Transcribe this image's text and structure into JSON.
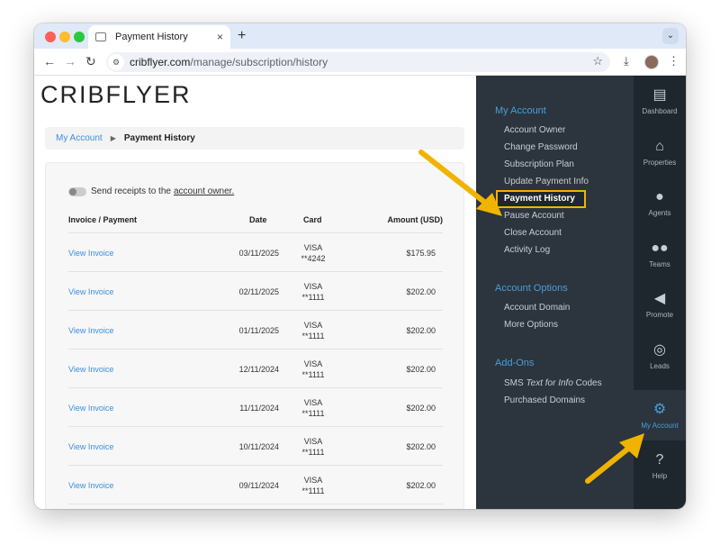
{
  "browser": {
    "tab_title": "Payment History",
    "close_tab": "×",
    "new_tab": "+",
    "url_domain": "cribflyer.com",
    "url_path": "/manage/subscription/history",
    "nav": {
      "back": "←",
      "forward": "→",
      "reload": "↻"
    },
    "star": "☆",
    "download": "⤓",
    "menu": "⋮",
    "tab_menu": "⌄",
    "colors": {
      "close": "#ff5f57",
      "minimize": "#febc2e",
      "maximize": "#28c840"
    }
  },
  "brand": {
    "logo_text": "CRIBFLYER"
  },
  "breadcrumb": {
    "parent": "My Account",
    "separator": "▶",
    "current": "Payment History"
  },
  "settings": {
    "toggle_label": "Send receipts to the",
    "toggle_link": "account owner.",
    "toggle_on": false
  },
  "table": {
    "columns": [
      "Invoice / Payment",
      "Date",
      "Card",
      "Amount (USD)"
    ],
    "rows": [
      {
        "invoice": "View Invoice",
        "date": "03/11/2025",
        "brand": "VISA",
        "last4": "**4242",
        "amount": "$175.95"
      },
      {
        "invoice": "View Invoice",
        "date": "02/11/2025",
        "brand": "VISA",
        "last4": "**1111",
        "amount": "$202.00"
      },
      {
        "invoice": "View Invoice",
        "date": "01/11/2025",
        "brand": "VISA",
        "last4": "**1111",
        "amount": "$202.00"
      },
      {
        "invoice": "View Invoice",
        "date": "12/11/2024",
        "brand": "VISA",
        "last4": "**1111",
        "amount": "$202.00"
      },
      {
        "invoice": "View Invoice",
        "date": "11/11/2024",
        "brand": "VISA",
        "last4": "**1111",
        "amount": "$202.00"
      },
      {
        "invoice": "View Invoice",
        "date": "10/11/2024",
        "brand": "VISA",
        "last4": "**1111",
        "amount": "$202.00"
      },
      {
        "invoice": "View Invoice",
        "date": "09/11/2024",
        "brand": "VISA",
        "last4": "**1111",
        "amount": "$202.00"
      }
    ]
  },
  "sidebar": {
    "my_account": {
      "title": "My Account",
      "items": [
        "Account Owner",
        "Change Password",
        "Subscription Plan",
        "Update Payment Info",
        "Payment History",
        "Pause Account",
        "Close Account",
        "Activity Log"
      ],
      "active": "Payment History"
    },
    "account_options": {
      "title": "Account Options",
      "items": [
        "Account Domain",
        "More Options"
      ]
    },
    "addons": {
      "title": "Add-Ons",
      "sms_prefix": "SMS",
      "sms_italic": "Text for Info",
      "sms_suffix": "Codes",
      "purchased": "Purchased Domains"
    }
  },
  "rail": [
    {
      "label": "Dashboard",
      "icon": "dashboard-icon"
    },
    {
      "label": "Properties",
      "icon": "properties-icon"
    },
    {
      "label": "Agents",
      "icon": "agent-icon"
    },
    {
      "label": "Teams",
      "icon": "teams-icon"
    },
    {
      "label": "Promote",
      "icon": "megaphone-icon"
    },
    {
      "label": "Leads",
      "icon": "target-icon"
    },
    {
      "label": "My Account",
      "icon": "gear-icon",
      "active": true
    },
    {
      "label": "Help",
      "icon": "help-icon"
    }
  ],
  "annotation_color": "#f0b400"
}
